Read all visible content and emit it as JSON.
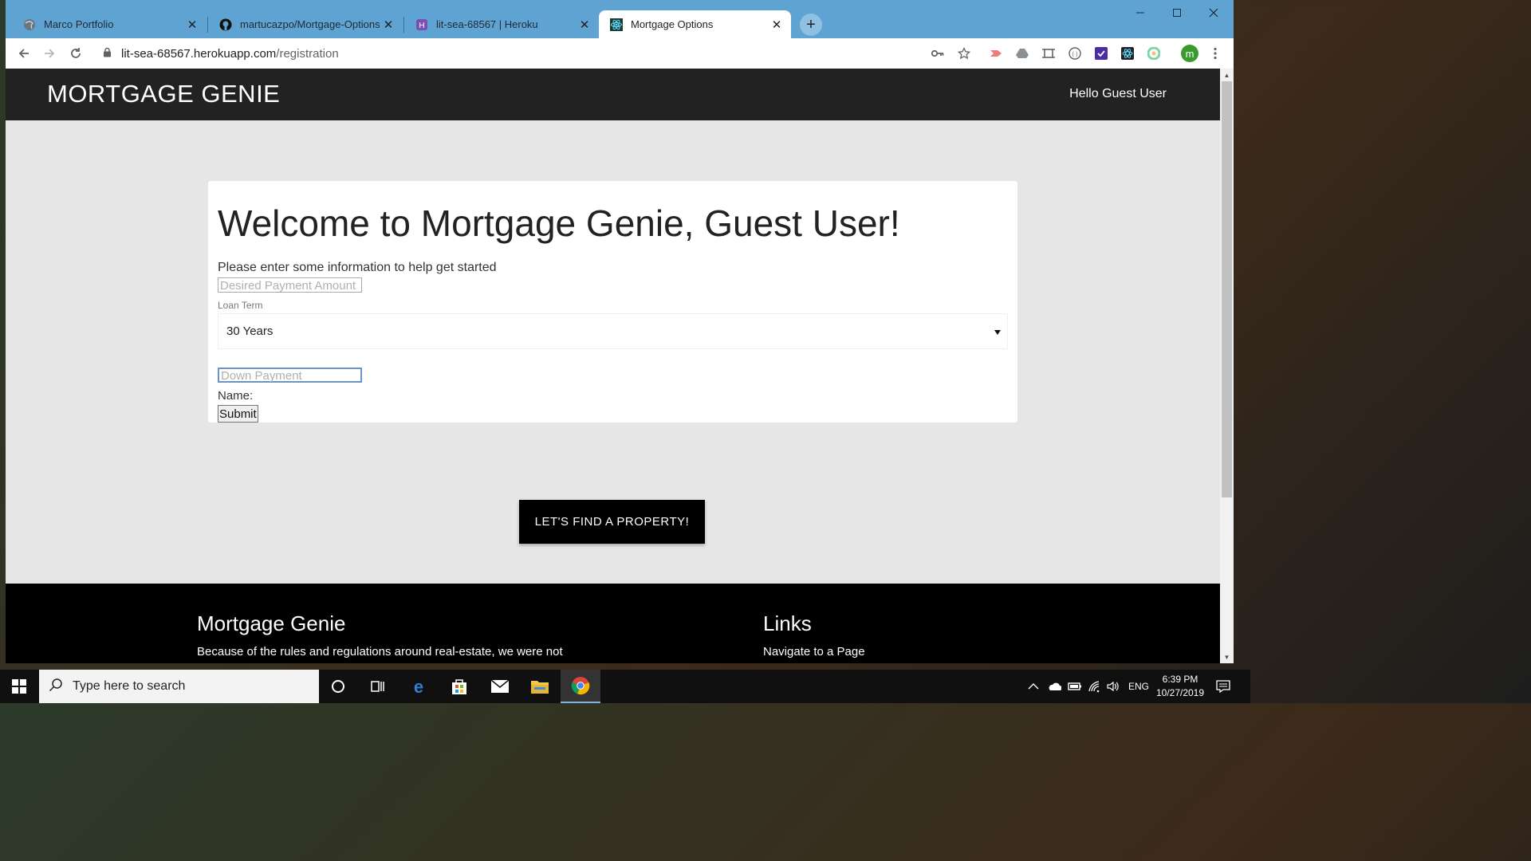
{
  "browser": {
    "tabs": [
      {
        "title": "Marco Portfolio",
        "icon": "globe-icon",
        "active": false
      },
      {
        "title": "martucazpo/Mortgage-Options",
        "icon": "github-icon",
        "active": false
      },
      {
        "title": "lit-sea-68567 | Heroku",
        "icon": "heroku-icon",
        "active": false
      },
      {
        "title": "Mortgage Options",
        "icon": "react-icon",
        "active": true
      }
    ],
    "close_glyph": "✕",
    "new_tab_glyph": "+",
    "url_host": "lit-sea-68567.herokuapp.com",
    "url_path": "/registration",
    "profile_initial": "m",
    "colors": {
      "tab_strip": "#5fa3d3",
      "profile": "#3a9a2e"
    }
  },
  "site": {
    "brand": "MORTGAGE GENIE",
    "greeting": "Hello Guest User"
  },
  "form": {
    "heading": "Welcome to Mortgage Genie, Guest User!",
    "intro": "Please enter some information to help get started",
    "payment_placeholder": "Desired Payment Amount",
    "loan_term_label": "Loan Term",
    "loan_term_value": "30 Years",
    "down_payment_placeholder": "Down Payment",
    "name_label": "Name:",
    "submit_label": "Submit"
  },
  "cta": {
    "label": "LET'S FIND A PROPERTY!"
  },
  "footer": {
    "col1_title": "Mortgage Genie",
    "col1_text": "Because of the rules and regulations around real-estate, we were not",
    "col2_title": "Links",
    "col2_text": "Navigate to a Page"
  },
  "taskbar": {
    "search_placeholder": "Type here to search",
    "language": "ENG",
    "time": "6:39 PM",
    "date": "10/27/2019"
  }
}
